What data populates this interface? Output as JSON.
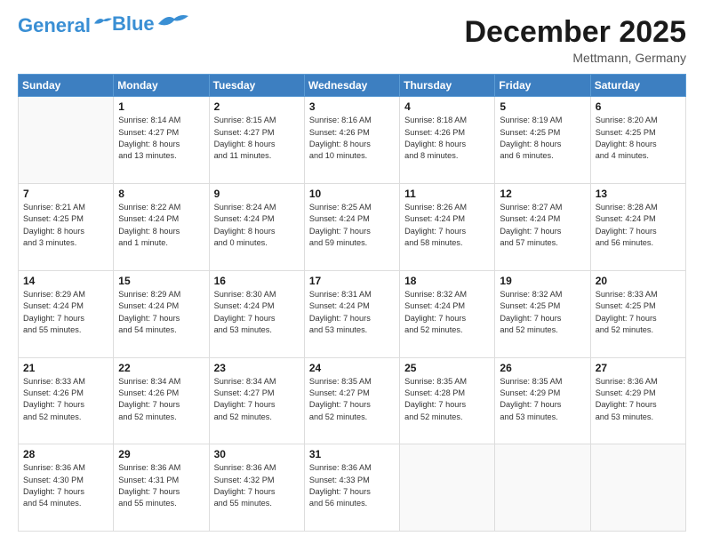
{
  "header": {
    "logo_line1": "General",
    "logo_line2": "Blue",
    "month": "December 2025",
    "location": "Mettmann, Germany"
  },
  "weekdays": [
    "Sunday",
    "Monday",
    "Tuesday",
    "Wednesday",
    "Thursday",
    "Friday",
    "Saturday"
  ],
  "weeks": [
    [
      {
        "day": "",
        "text": ""
      },
      {
        "day": "1",
        "text": "Sunrise: 8:14 AM\nSunset: 4:27 PM\nDaylight: 8 hours\nand 13 minutes."
      },
      {
        "day": "2",
        "text": "Sunrise: 8:15 AM\nSunset: 4:27 PM\nDaylight: 8 hours\nand 11 minutes."
      },
      {
        "day": "3",
        "text": "Sunrise: 8:16 AM\nSunset: 4:26 PM\nDaylight: 8 hours\nand 10 minutes."
      },
      {
        "day": "4",
        "text": "Sunrise: 8:18 AM\nSunset: 4:26 PM\nDaylight: 8 hours\nand 8 minutes."
      },
      {
        "day": "5",
        "text": "Sunrise: 8:19 AM\nSunset: 4:25 PM\nDaylight: 8 hours\nand 6 minutes."
      },
      {
        "day": "6",
        "text": "Sunrise: 8:20 AM\nSunset: 4:25 PM\nDaylight: 8 hours\nand 4 minutes."
      }
    ],
    [
      {
        "day": "7",
        "text": "Sunrise: 8:21 AM\nSunset: 4:25 PM\nDaylight: 8 hours\nand 3 minutes."
      },
      {
        "day": "8",
        "text": "Sunrise: 8:22 AM\nSunset: 4:24 PM\nDaylight: 8 hours\nand 1 minute."
      },
      {
        "day": "9",
        "text": "Sunrise: 8:24 AM\nSunset: 4:24 PM\nDaylight: 8 hours\nand 0 minutes."
      },
      {
        "day": "10",
        "text": "Sunrise: 8:25 AM\nSunset: 4:24 PM\nDaylight: 7 hours\nand 59 minutes."
      },
      {
        "day": "11",
        "text": "Sunrise: 8:26 AM\nSunset: 4:24 PM\nDaylight: 7 hours\nand 58 minutes."
      },
      {
        "day": "12",
        "text": "Sunrise: 8:27 AM\nSunset: 4:24 PM\nDaylight: 7 hours\nand 57 minutes."
      },
      {
        "day": "13",
        "text": "Sunrise: 8:28 AM\nSunset: 4:24 PM\nDaylight: 7 hours\nand 56 minutes."
      }
    ],
    [
      {
        "day": "14",
        "text": "Sunrise: 8:29 AM\nSunset: 4:24 PM\nDaylight: 7 hours\nand 55 minutes."
      },
      {
        "day": "15",
        "text": "Sunrise: 8:29 AM\nSunset: 4:24 PM\nDaylight: 7 hours\nand 54 minutes."
      },
      {
        "day": "16",
        "text": "Sunrise: 8:30 AM\nSunset: 4:24 PM\nDaylight: 7 hours\nand 53 minutes."
      },
      {
        "day": "17",
        "text": "Sunrise: 8:31 AM\nSunset: 4:24 PM\nDaylight: 7 hours\nand 53 minutes."
      },
      {
        "day": "18",
        "text": "Sunrise: 8:32 AM\nSunset: 4:24 PM\nDaylight: 7 hours\nand 52 minutes."
      },
      {
        "day": "19",
        "text": "Sunrise: 8:32 AM\nSunset: 4:25 PM\nDaylight: 7 hours\nand 52 minutes."
      },
      {
        "day": "20",
        "text": "Sunrise: 8:33 AM\nSunset: 4:25 PM\nDaylight: 7 hours\nand 52 minutes."
      }
    ],
    [
      {
        "day": "21",
        "text": "Sunrise: 8:33 AM\nSunset: 4:26 PM\nDaylight: 7 hours\nand 52 minutes."
      },
      {
        "day": "22",
        "text": "Sunrise: 8:34 AM\nSunset: 4:26 PM\nDaylight: 7 hours\nand 52 minutes."
      },
      {
        "day": "23",
        "text": "Sunrise: 8:34 AM\nSunset: 4:27 PM\nDaylight: 7 hours\nand 52 minutes."
      },
      {
        "day": "24",
        "text": "Sunrise: 8:35 AM\nSunset: 4:27 PM\nDaylight: 7 hours\nand 52 minutes."
      },
      {
        "day": "25",
        "text": "Sunrise: 8:35 AM\nSunset: 4:28 PM\nDaylight: 7 hours\nand 52 minutes."
      },
      {
        "day": "26",
        "text": "Sunrise: 8:35 AM\nSunset: 4:29 PM\nDaylight: 7 hours\nand 53 minutes."
      },
      {
        "day": "27",
        "text": "Sunrise: 8:36 AM\nSunset: 4:29 PM\nDaylight: 7 hours\nand 53 minutes."
      }
    ],
    [
      {
        "day": "28",
        "text": "Sunrise: 8:36 AM\nSunset: 4:30 PM\nDaylight: 7 hours\nand 54 minutes."
      },
      {
        "day": "29",
        "text": "Sunrise: 8:36 AM\nSunset: 4:31 PM\nDaylight: 7 hours\nand 55 minutes."
      },
      {
        "day": "30",
        "text": "Sunrise: 8:36 AM\nSunset: 4:32 PM\nDaylight: 7 hours\nand 55 minutes."
      },
      {
        "day": "31",
        "text": "Sunrise: 8:36 AM\nSunset: 4:33 PM\nDaylight: 7 hours\nand 56 minutes."
      },
      {
        "day": "",
        "text": ""
      },
      {
        "day": "",
        "text": ""
      },
      {
        "day": "",
        "text": ""
      }
    ]
  ]
}
